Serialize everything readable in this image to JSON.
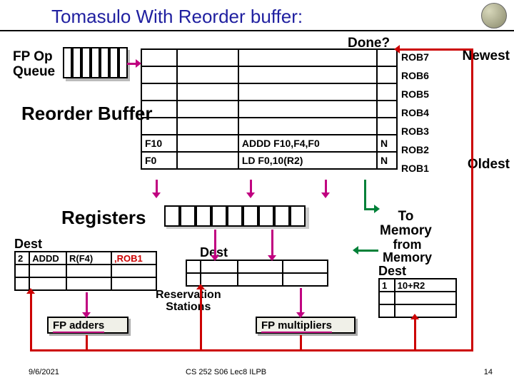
{
  "title": "Tomasulo With Reorder buffer:",
  "done_label": "Done?",
  "newest_label": "Newest",
  "oldest_label": "Oldest",
  "fp_op_queue_label": "FP Op\nQueue",
  "reorder_buffer_label": "Reorder Buffer",
  "registers_label": "Registers",
  "to_memory_label": "To\nMemory",
  "from_memory_label": "from\nMemory",
  "dest_label": "Dest",
  "res_stations_label": "Reservation\nStations",
  "fp_adders_label": "FP adders",
  "fp_multipliers_label": "FP multipliers",
  "rob_rows": [
    {
      "id": "ROB7",
      "dest": "",
      "instr": "",
      "done": ""
    },
    {
      "id": "ROB6",
      "dest": "",
      "instr": "",
      "done": ""
    },
    {
      "id": "ROB5",
      "dest": "",
      "instr": "",
      "done": ""
    },
    {
      "id": "ROB4",
      "dest": "",
      "instr": "",
      "done": ""
    },
    {
      "id": "ROB3",
      "dest": "",
      "instr": "",
      "done": ""
    },
    {
      "id": "ROB2",
      "dest": "F10",
      "instr": "ADDD F10,F4,F0",
      "done": "N"
    },
    {
      "id": "ROB1",
      "dest": "F0",
      "instr": "LD F0,10(R2)",
      "done": "N"
    }
  ],
  "rs_left": {
    "tag": "2",
    "op": "ADDD",
    "src1": "R(F4)",
    "src2": ",ROB1"
  },
  "rs_right": {
    "tag": "1",
    "addr": "10+R2"
  },
  "footer": {
    "date": "9/6/2021",
    "center": "CS 252 S06 Lec8 ILPB",
    "page": "14"
  }
}
